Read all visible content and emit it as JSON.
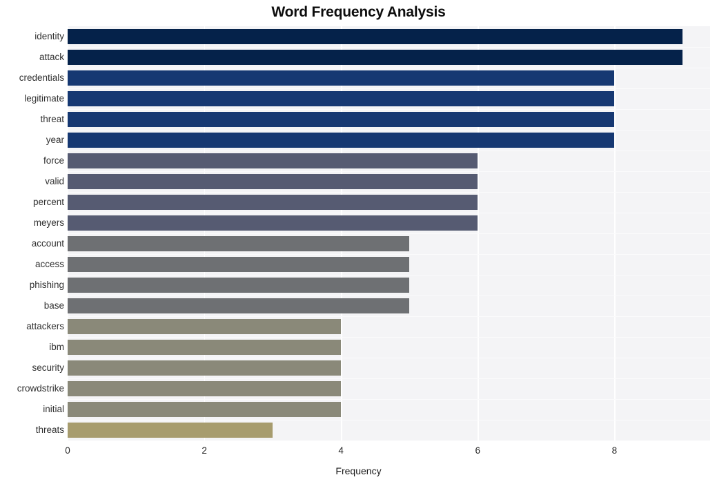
{
  "chart_data": {
    "type": "bar",
    "orientation": "horizontal",
    "title": "Word Frequency Analysis",
    "xlabel": "Frequency",
    "ylabel": "",
    "xlim": [
      0,
      9.4
    ],
    "xticks": [
      0,
      2,
      4,
      6,
      8
    ],
    "xtick_labels": [
      "0",
      "2",
      "4",
      "6",
      "8"
    ],
    "grid": true,
    "legend": null,
    "categories": [
      "identity",
      "attack",
      "credentials",
      "legitimate",
      "threat",
      "year",
      "force",
      "valid",
      "percent",
      "meyers",
      "account",
      "access",
      "phishing",
      "base",
      "attackers",
      "ibm",
      "security",
      "crowdstrike",
      "initial",
      "threats"
    ],
    "values": [
      9,
      9,
      8,
      8,
      8,
      8,
      6,
      6,
      6,
      6,
      5,
      5,
      5,
      5,
      4,
      4,
      4,
      4,
      4,
      3
    ],
    "bar_colors": [
      "#05224a",
      "#05224a",
      "#163872",
      "#163872",
      "#163872",
      "#163872",
      "#565b72",
      "#565b72",
      "#565b72",
      "#565b72",
      "#6e7073",
      "#6e7073",
      "#6e7073",
      "#6e7073",
      "#8a8979",
      "#8a8979",
      "#8a8979",
      "#8a8979",
      "#8a8979",
      "#a79c6e"
    ],
    "plot_background": "#f4f4f6",
    "gridline_color": "#ffffff"
  }
}
